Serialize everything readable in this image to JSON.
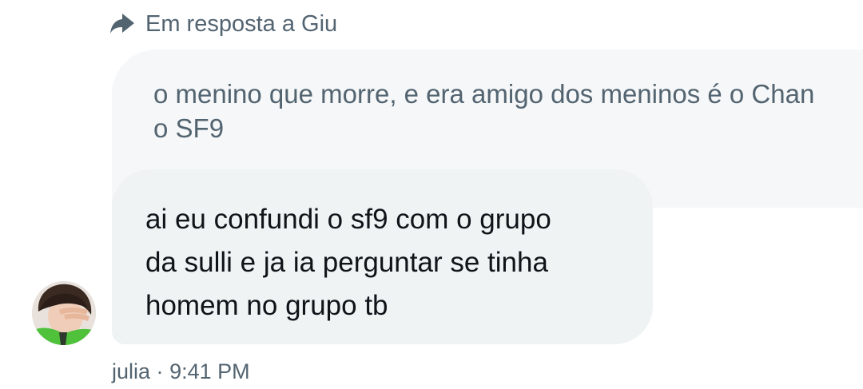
{
  "reply": {
    "icon": "reply-arrow-icon",
    "label": "Em resposta a Giu"
  },
  "quoted_message": {
    "text": "o menino que morre, e era amigo dos meninos é o Chan\no SF9"
  },
  "message": {
    "text": "ai eu confundi o sf9 com o grupo\nda sulli e ja ia perguntar se tinha\nhomem no grupo tb",
    "author": "julia",
    "separator": "·",
    "time": "9:41 PM"
  },
  "avatar": {
    "icon": "user-avatar"
  },
  "colors": {
    "secondary_text": "#536471",
    "bubble_bg": "#eff3f4",
    "quoted_bg": "#f5f7f8",
    "primary_text": "#0f1419"
  }
}
